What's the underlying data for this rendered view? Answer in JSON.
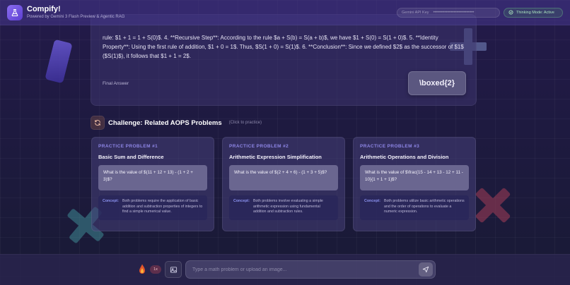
{
  "header": {
    "title": "Compify!",
    "subtitle": "Powered by Gemini 3 Flash Preview & Agentic RAG",
    "api_key_label": "Gemini API Key",
    "api_key_masked": "••••••••••••••••••••••••••••••••",
    "thinking_mode": "Thinking Mode: Active"
  },
  "solution": {
    "text": "rule: $1 + 1 = 1 + S(0)$. 4. **Recursive Step**: According to the rule $a + S(b) = S(a + b)$, we have $1 + S(0) = S(1 + 0)$. 5. **Identity Property**: Using the first rule of addition, $1 + 0 = 1$. Thus, $S(1 + 0) = S(1)$. 6. **Conclusion**: Since we defined $2$ as the successor of $1$ ($S(1)$), it follows that $1 + 1 = 2$.",
    "final_answer_label": "Final Answer",
    "final_answer": "\\boxed{2}"
  },
  "challenge": {
    "title": "Challenge: Related AOPS Problems",
    "hint": "(Click to practice)",
    "problems": [
      {
        "label": "PRACTICE PROBLEM #1",
        "title": "Basic Sum and Difference",
        "question": "What is the value of $(11 + 12 + 13) - (1 + 2 + 3)$?",
        "concept_label": "Concept:",
        "concept": "Both problems require the application of basic addition and subtraction properties of integers to find a simple numerical value."
      },
      {
        "label": "PRACTICE PROBLEM #2",
        "title": "Arithmetic Expression Simplification",
        "question": "What is the value of $(2 + 4 + 6) - (1 + 3 + 5)$?",
        "concept_label": "Concept:",
        "concept": "Both problems involve evaluating a simple arithmetic expression using fundamental addition and subtraction rules."
      },
      {
        "label": "PRACTICE PROBLEM #3",
        "title": "Arithmetic Operations and Division",
        "question": "What is the value of $\\frac{15 - 14 + 13 - 12 + 11 - 10}{1 + 1 + 1}$?",
        "concept_label": "Concept:",
        "concept": "Both problems utilize basic arithmetic operations and the order of operations to evaluate a numeric expression."
      }
    ]
  },
  "input_bar": {
    "speed": "1x",
    "placeholder": "Type a math problem or upload an image..."
  },
  "colors": {
    "accent": "#8e86e6",
    "concept": "#8b92f0",
    "thinking_active": "#a9e2bd"
  },
  "icons": {
    "logo": "flask-icon",
    "thinking": "check-circle-icon",
    "refresh": "refresh-icon",
    "flame": "flame-icon",
    "image": "image-icon",
    "send": "send-icon"
  }
}
